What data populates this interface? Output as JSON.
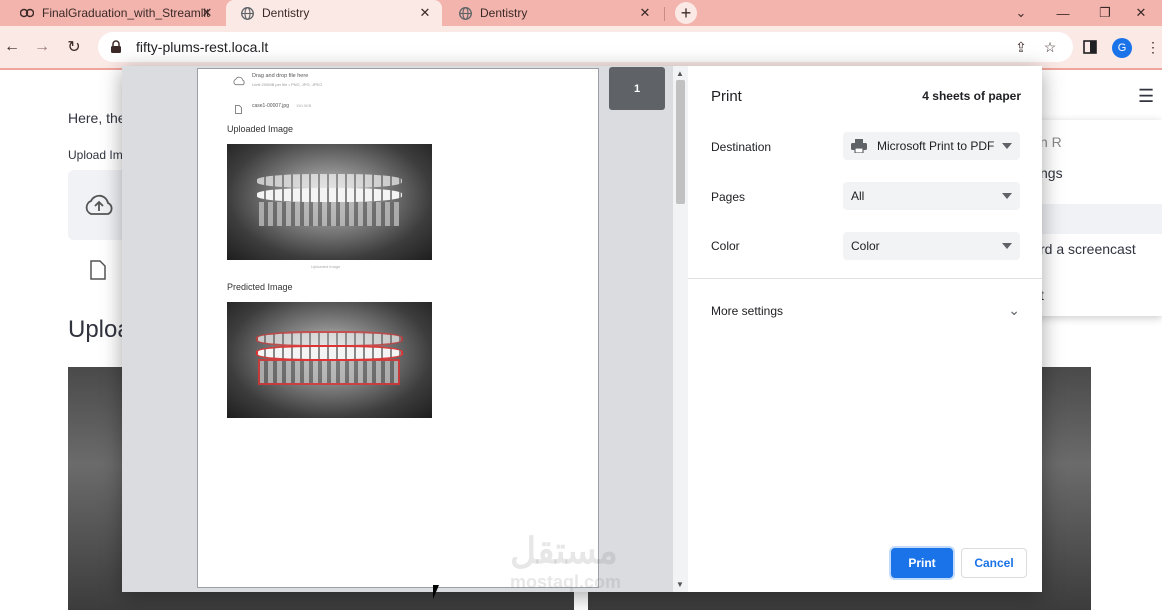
{
  "browser": {
    "tabs": [
      {
        "title": "FinalGraduation_with_Streamlit"
      },
      {
        "title": "Dentistry"
      },
      {
        "title": "Dentistry"
      }
    ],
    "url": "fifty-plums-rest.loca.lt",
    "profile_initial": "G"
  },
  "background_page": {
    "intro_text": "Here, the",
    "upload_label": "Upload Im",
    "section_heading": "Uploa",
    "menu_items": [
      "n R",
      "ngs",
      "rd a screencast",
      "t"
    ]
  },
  "print_preview": {
    "dropzone_title": "Drag and drop file here",
    "dropzone_limit": "Limit 200MB per file • PNG, JPG, JPEG",
    "file_name": "case1-00007.jpg",
    "file_size": "150.0KB",
    "uploaded_heading": "Uploaded Image",
    "uploaded_caption": "Uploaded Image",
    "predicted_heading": "Predicted Image",
    "page_number": "1"
  },
  "print_settings": {
    "title": "Print",
    "sheets": "4 sheets of paper",
    "destination_label": "Destination",
    "destination_value": "Microsoft Print to PDF",
    "pages_label": "Pages",
    "pages_value": "All",
    "color_label": "Color",
    "color_value": "Color",
    "more_settings": "More settings",
    "print_button": "Print",
    "cancel_button": "Cancel"
  },
  "watermark": {
    "text": "مستقل",
    "subtext": "mostaql.com"
  }
}
